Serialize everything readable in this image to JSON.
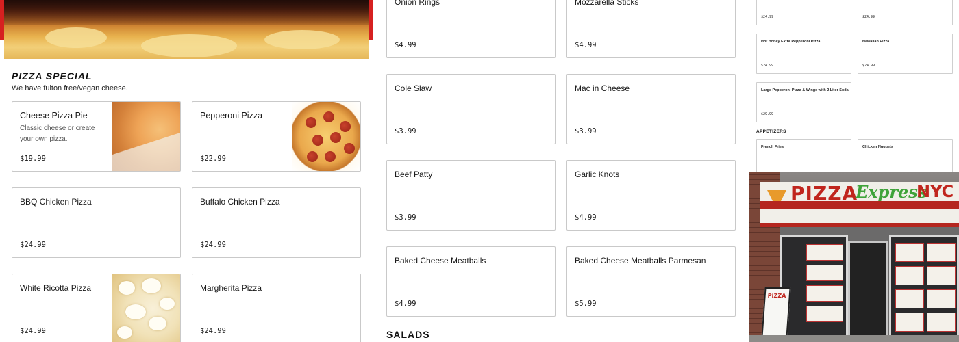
{
  "left": {
    "section_title": "PIZZA SPECIAL",
    "section_sub": "We have fulton free/vegan cheese.",
    "items": [
      {
        "name": "Cheese Pizza Pie",
        "desc": "Classic cheese or create your own pizza.",
        "price": "$19.99"
      },
      {
        "name": "Pepperoni Pizza",
        "desc": "",
        "price": "$22.99"
      },
      {
        "name": "BBQ Chicken Pizza",
        "desc": "",
        "price": "$24.99"
      },
      {
        "name": "Buffalo Chicken Pizza",
        "desc": "",
        "price": "$24.99"
      },
      {
        "name": "White Ricotta Pizza",
        "desc": "",
        "price": "$24.99"
      },
      {
        "name": "Margherita Pizza",
        "desc": "",
        "price": "$24.99"
      }
    ]
  },
  "middle": {
    "items": [
      {
        "name": "Onion Rings",
        "price": "$4.99"
      },
      {
        "name": "Mozzarella Sticks",
        "price": "$4.99"
      },
      {
        "name": "Cole Slaw",
        "price": "$3.99"
      },
      {
        "name": "Mac in Cheese",
        "price": "$3.99"
      },
      {
        "name": "Beef Patty",
        "price": "$3.99"
      },
      {
        "name": "Garlic Knots",
        "price": "$4.99"
      },
      {
        "name": "Baked Cheese Meatballs",
        "price": "$4.99"
      },
      {
        "name": "Baked Cheese Meatballs Parmesan",
        "price": "$5.99"
      }
    ],
    "next_section_title": "SALADS"
  },
  "right": {
    "items": [
      {
        "name": "",
        "price": "$24.99"
      },
      {
        "name": "",
        "price": "$24.99"
      },
      {
        "name": "Hot Honey Extra Pepperoni Pizza",
        "price": "$24.99"
      },
      {
        "name": "Hawaiian Pizza",
        "price": "$24.99"
      },
      {
        "name": "Large Pepperoni Pizza & Wings with 2 Liter Soda",
        "price": "$29.99"
      }
    ],
    "appetizers_heading": "APPETIZERS",
    "appetizers": [
      {
        "name": "French Fries",
        "price": ""
      },
      {
        "name": "Chicken Nuggets",
        "price": ""
      }
    ]
  },
  "storefront": {
    "sign_word": "PIZZA",
    "sign_script": "Express",
    "sign_city": "NYC",
    "aframe_text": "PIZZA"
  }
}
